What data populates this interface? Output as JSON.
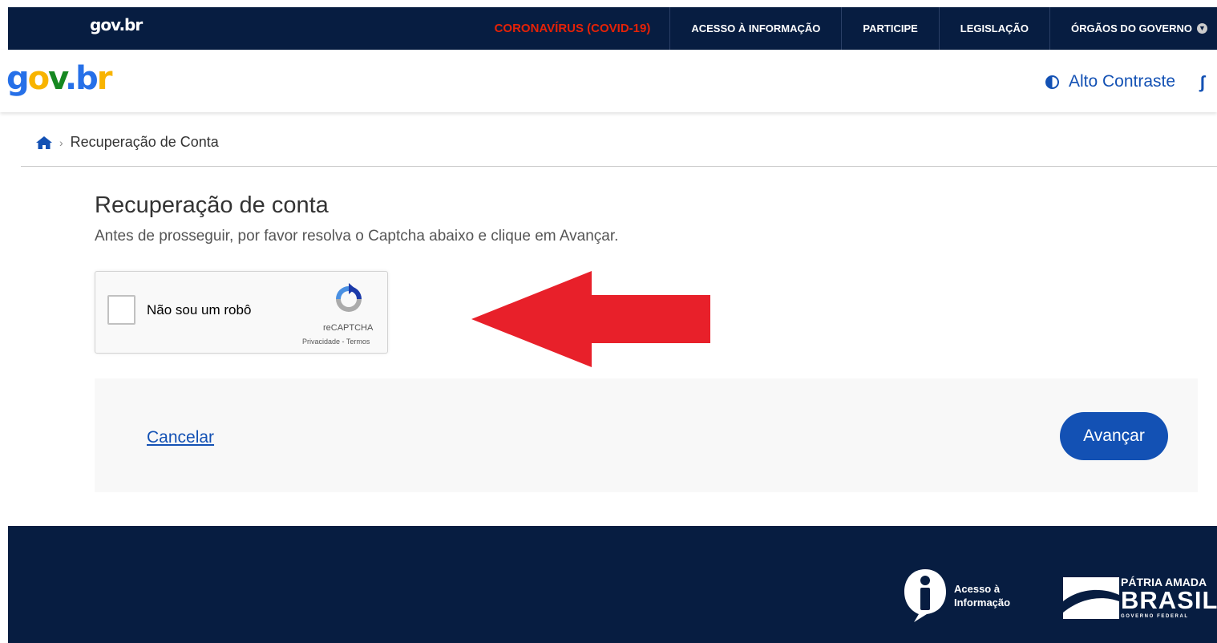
{
  "topbar": {
    "logo": "gov.br",
    "nav": [
      "CORONAVÍRUS (COVID-19)",
      "ACESSO À INFORMAÇÃO",
      "PARTICIPE",
      "LEGISLAÇÃO",
      "ÓRGÃOS DO GOVERNO"
    ]
  },
  "header": {
    "brand": "gov.br",
    "contrast_label": "Alto Contraste"
  },
  "breadcrumb": {
    "current": "Recuperação de Conta"
  },
  "main": {
    "title": "Recuperação de conta",
    "subtitle": "Antes de prosseguir, por favor resolva o Captcha abaixo e clique em Avançar.",
    "captcha": {
      "checkbox_label": "Não sou um robô",
      "brand": "reCAPTCHA",
      "links": "Privacidade - Termos"
    },
    "actions": {
      "cancel": "Cancelar",
      "advance": "Avançar"
    }
  },
  "footer": {
    "lai": "Acesso à Informação",
    "patria_top": "PÁTRIA AMADA",
    "patria_main": "BRASIL",
    "patria_sub": "GOVERNO FEDERAL"
  },
  "colors": {
    "dark_blue": "#071d41",
    "primary": "#1351b4",
    "covid_red": "#e52207",
    "arrow_red": "#e8202a"
  }
}
